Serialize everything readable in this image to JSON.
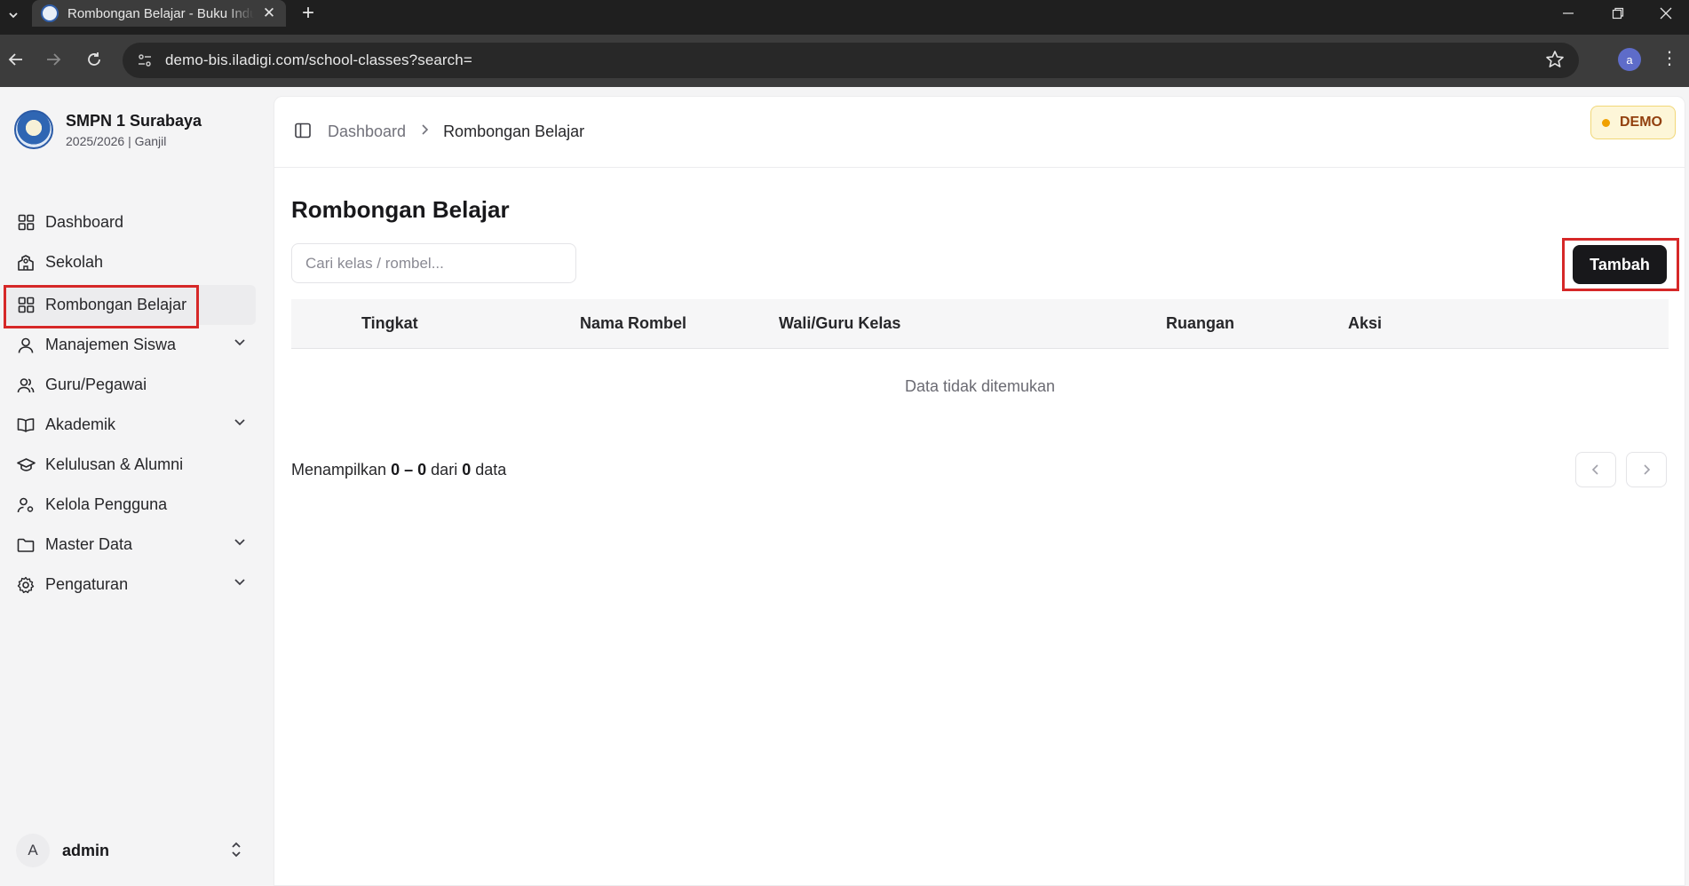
{
  "browser": {
    "tab_title": "Rombongan Belajar - Buku Induk",
    "url": "demo-bis.iladigi.com/school-classes?search=",
    "profile_initial": "a"
  },
  "school": {
    "name": "SMPN 1 Surabaya",
    "period": "2025/2026 | Ganjil"
  },
  "sidebar": {
    "items": [
      {
        "label": "Dashboard",
        "icon": "dashboard-grid-icon"
      },
      {
        "label": "Sekolah",
        "icon": "school-building-icon"
      },
      {
        "label": "Rombongan Belajar",
        "icon": "grid-icon",
        "active": true
      },
      {
        "label": "Manajemen Siswa",
        "icon": "user-icon",
        "expandable": true
      },
      {
        "label": "Guru/Pegawai",
        "icon": "users-icon"
      },
      {
        "label": "Akademik",
        "icon": "book-open-icon",
        "expandable": true
      },
      {
        "label": "Kelulusan & Alumni",
        "icon": "graduation-cap-icon"
      },
      {
        "label": "Kelola Pengguna",
        "icon": "user-cog-icon"
      },
      {
        "label": "Master Data",
        "icon": "folder-icon",
        "expandable": true
      },
      {
        "label": "Pengaturan",
        "icon": "gear-icon",
        "expandable": true
      }
    ]
  },
  "user": {
    "initial": "A",
    "name": "admin"
  },
  "breadcrumb": {
    "parent": "Dashboard",
    "current": "Rombongan Belajar"
  },
  "badge": {
    "label": "DEMO",
    "color": "#f0a000"
  },
  "page": {
    "title": "Rombongan Belajar",
    "search_placeholder": "Cari kelas / rombel...",
    "search_value": "",
    "add_button": "Tambah"
  },
  "table": {
    "columns": [
      "Tingkat",
      "Nama Rombel",
      "Wali/Guru Kelas",
      "Ruangan",
      "Aksi"
    ],
    "rows": [],
    "empty_text": "Data tidak ditemukan"
  },
  "pagination": {
    "prefix": "Menampilkan",
    "from": "0",
    "dash": "–",
    "to": "0",
    "of_word": "dari",
    "total": "0",
    "suffix": "data"
  },
  "colors": {
    "accent_dark": "#18181b",
    "highlight_red": "#d62828"
  }
}
